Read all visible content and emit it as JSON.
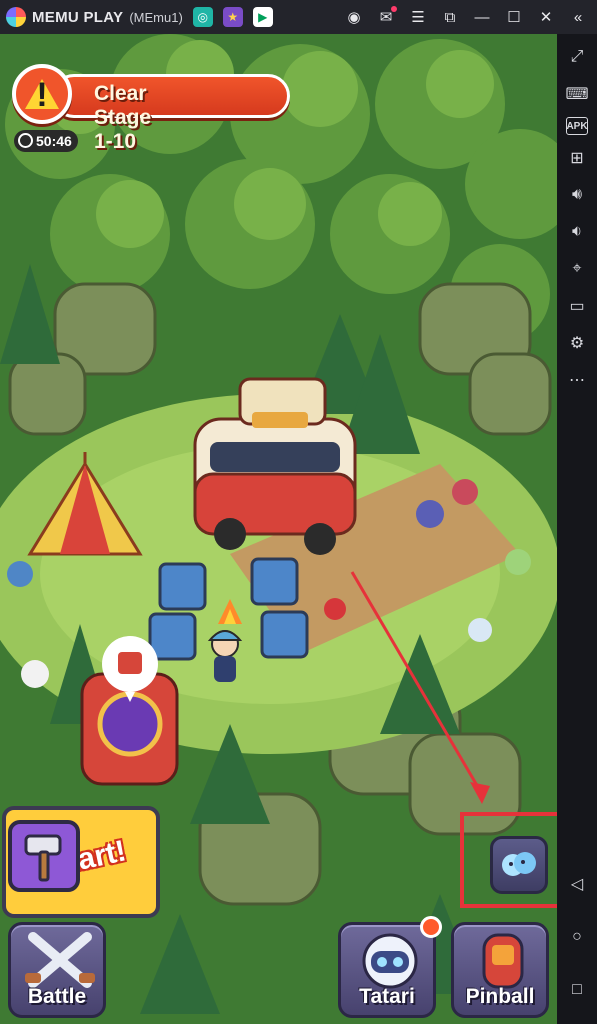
{
  "emulator": {
    "brand": "MEMU PLAY",
    "instance": "(MEmu1)"
  },
  "quest": {
    "title": "Clear Stage 1-10",
    "timer": "50:46"
  },
  "start_panel": {
    "text": "tart!"
  },
  "nav": {
    "battle_label": "Battle",
    "tatari_label": "Tatari",
    "pinball_label": "Pinball"
  },
  "colors": {
    "highlight": "#e6323a",
    "quest_red": "#f0552b",
    "nav_purple": "#5b5688",
    "grass": "#9ac65b"
  }
}
